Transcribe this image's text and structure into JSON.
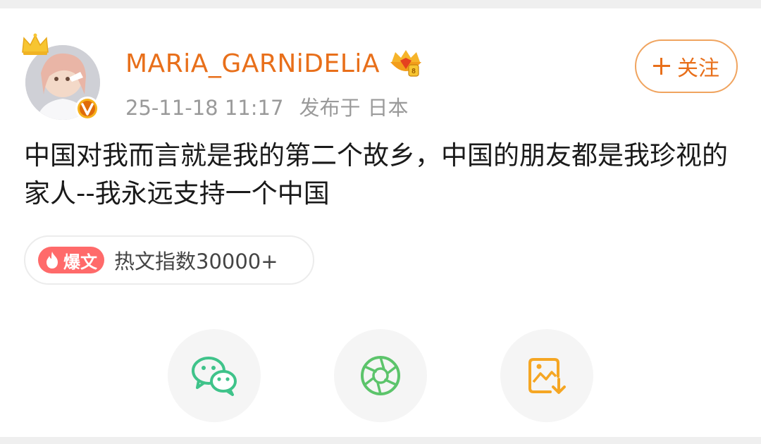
{
  "post": {
    "username": "MARiA_GARNiDELiA",
    "timestamp": "25-11-18 11:17",
    "location_prefix": "发布于",
    "location": "日本",
    "follow_label": "关注",
    "content": "中国对我而言就是我的第二个故乡，中国的朋友都是我珍视的家人--我永远支持一个中国",
    "hot_tag": "爆文",
    "hot_index": "热文指数30000+"
  },
  "share": {
    "items": [
      {
        "icon": "wechat-icon"
      },
      {
        "icon": "moments-icon"
      },
      {
        "icon": "save-image-icon"
      }
    ]
  },
  "colors": {
    "accent": "#e86f1a",
    "hot_tag": "#ff6a6a",
    "wechat": "#3fc38a",
    "moments": "#5cc46b",
    "save": "#f5a623"
  }
}
